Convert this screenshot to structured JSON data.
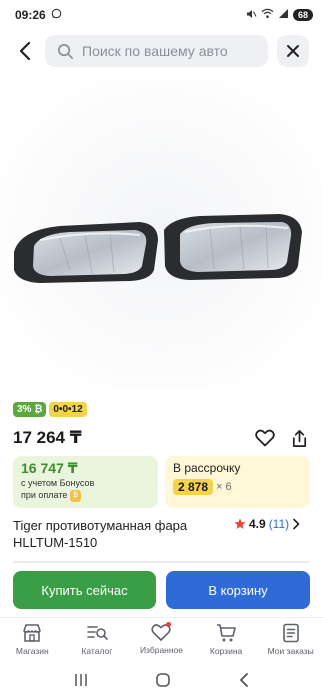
{
  "status_bar": {
    "time": "09:26",
    "battery": "68"
  },
  "search": {
    "placeholder": "Поиск по вашему авто"
  },
  "badges": {
    "bonus": "3% ₿",
    "installment": "0•0•12"
  },
  "price": "17 264 ₸",
  "bonus_card": {
    "amount": "16 747 ₸",
    "note_line1": "с учетом Бонусов",
    "note_line2": "при оплате"
  },
  "installment_card": {
    "title": "В рассрочку",
    "amount": "2 878",
    "multiplier": "× 6"
  },
  "product": {
    "title": "Tiger противотуманная фара HLLTUM-1510"
  },
  "rating": {
    "value": "4.9",
    "count": "(11)"
  },
  "buttons": {
    "buy_now": "Купить сейчас",
    "add_to_cart": "В корзину"
  },
  "tabbar": [
    {
      "label": "Магазин",
      "icon": "store-icon"
    },
    {
      "label": "Каталог",
      "icon": "catalog-icon"
    },
    {
      "label": "Избранное",
      "icon": "heart-icon"
    },
    {
      "label": "Корзина",
      "icon": "cart-icon"
    },
    {
      "label": "Мои заказы",
      "icon": "orders-icon"
    }
  ],
  "colors": {
    "accent_green": "#3a9e47",
    "accent_blue": "#2f6bd6",
    "bonus_badge": "#5aa93d",
    "installment_badge": "#f4d24a",
    "rating_star": "#e8413a"
  }
}
